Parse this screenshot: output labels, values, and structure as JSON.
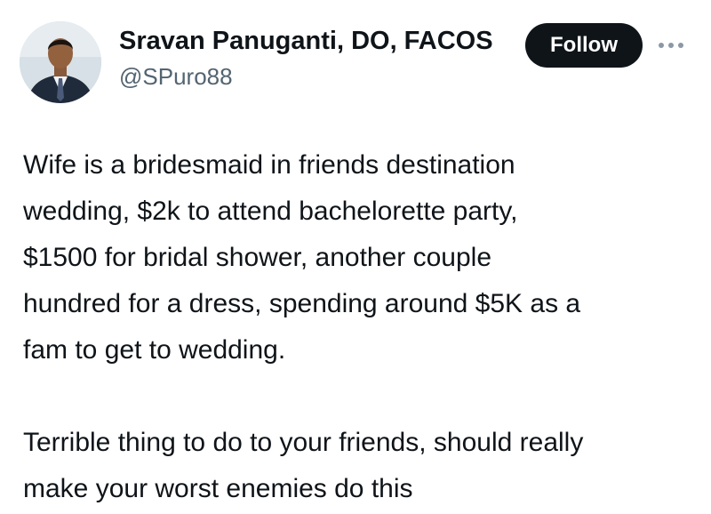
{
  "author": {
    "display_name": "Sravan Panuganti, DO, FACOS",
    "handle": "@SPuro88",
    "avatar_icon": "profile-photo"
  },
  "actions": {
    "follow_label": "Follow",
    "more_icon": "more-horizontal-icon"
  },
  "tweet": {
    "paragraphs": [
      "Wife is a bridesmaid in friends destination\nwedding, $2k to attend bachelorette party,\n$1500 for bridal shower, another couple\nhundred for a dress, spending around $5K as a\nfam to get to wedding.",
      "Terrible thing to do to your friends, should really\nmake your worst enemies do this"
    ]
  },
  "colors": {
    "text_primary": "#0f1419",
    "text_secondary": "#536471",
    "follow_button_bg": "#0f1419",
    "follow_button_text": "#ffffff"
  }
}
